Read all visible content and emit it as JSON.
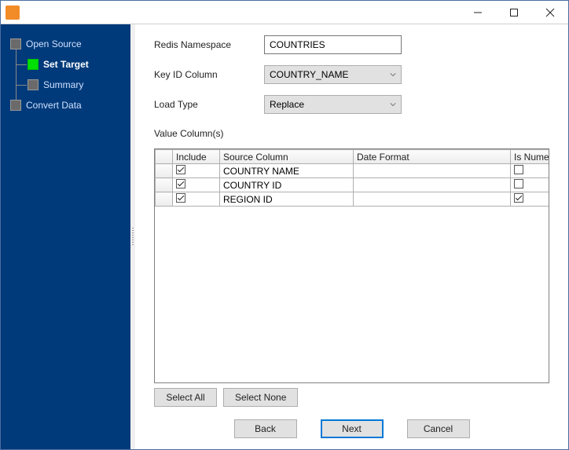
{
  "window": {
    "title": ""
  },
  "sidebar": {
    "steps": [
      {
        "label": "Open Source",
        "active": false,
        "level": 0
      },
      {
        "label": "Set Target",
        "active": true,
        "level": 1
      },
      {
        "label": "Summary",
        "active": false,
        "level": 1
      },
      {
        "label": "Convert Data",
        "active": false,
        "level": 0
      }
    ]
  },
  "form": {
    "redis_namespace": {
      "label": "Redis Namespace",
      "value": "COUNTRIES"
    },
    "key_id_column": {
      "label": "Key ID Column",
      "value": "COUNTRY_NAME"
    },
    "load_type": {
      "label": "Load Type",
      "value": "Replace"
    },
    "value_columns_label": "Value Column(s)"
  },
  "grid": {
    "headers": {
      "include": "Include",
      "source": "Source Column",
      "date": "Date Format",
      "numeric": "Is Numeric"
    },
    "rows": [
      {
        "include": true,
        "source": "COUNTRY NAME",
        "date": "",
        "numeric": false
      },
      {
        "include": true,
        "source": "COUNTRY ID",
        "date": "",
        "numeric": false
      },
      {
        "include": true,
        "source": "REGION ID",
        "date": "",
        "numeric": true
      }
    ]
  },
  "buttons": {
    "select_all": "Select All",
    "select_none": "Select None",
    "back": "Back",
    "next": "Next",
    "cancel": "Cancel"
  }
}
